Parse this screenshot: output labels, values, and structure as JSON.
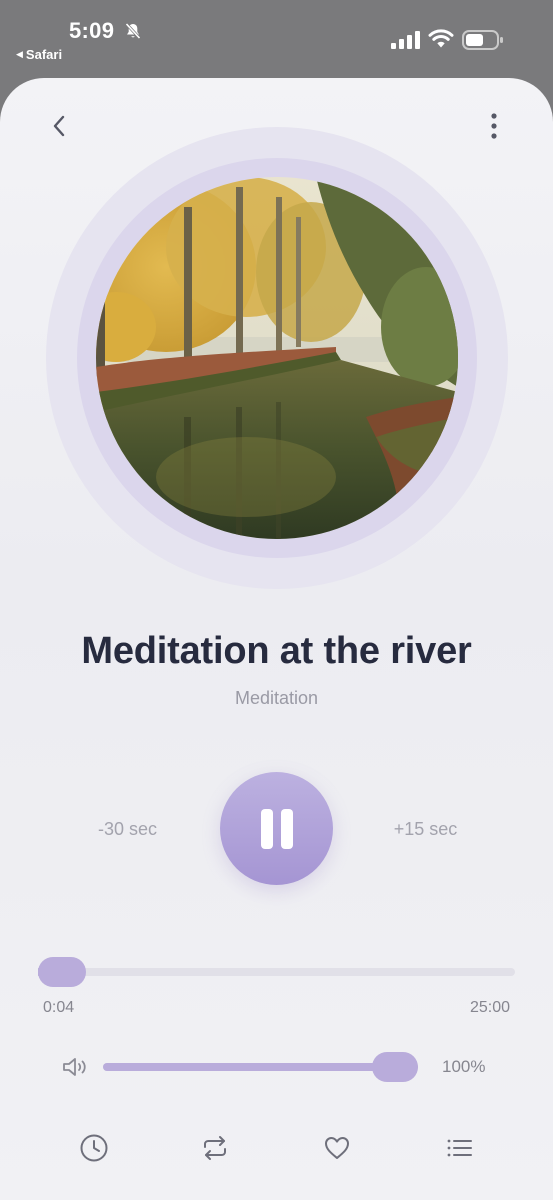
{
  "status_bar": {
    "time": "5:09",
    "back_app": "Safari",
    "icons": [
      "bell-slash-icon",
      "signal-icon",
      "wifi-icon",
      "battery-icon"
    ]
  },
  "nav": {
    "back_icon": "chevron-left-icon",
    "more_icon": "more-vertical-icon"
  },
  "track": {
    "title": "Meditation at the river",
    "subtitle": "Meditation",
    "artwork": "river-autumn-trees-image"
  },
  "controls": {
    "skip_back": "-30 sec",
    "skip_forward": "+15 sec",
    "play_state": "playing",
    "main_icon": "pause-icon"
  },
  "progress": {
    "elapsed": "0:04",
    "total": "25:00",
    "fraction": 0.003
  },
  "volume": {
    "level_percent": 100,
    "label": "100%",
    "icon": "speaker-icon"
  },
  "bottom_bar": [
    {
      "name": "history",
      "icon": "clock-icon"
    },
    {
      "name": "repeat",
      "icon": "repeat-icon"
    },
    {
      "name": "favorite",
      "icon": "heart-icon"
    },
    {
      "name": "playlist",
      "icon": "list-icon"
    }
  ],
  "colors": {
    "accent": "#b9acdb",
    "play_button": "#a595d3",
    "title": "#272b3f",
    "muted_text": "#9a9aa5",
    "background": "#efeff3"
  }
}
